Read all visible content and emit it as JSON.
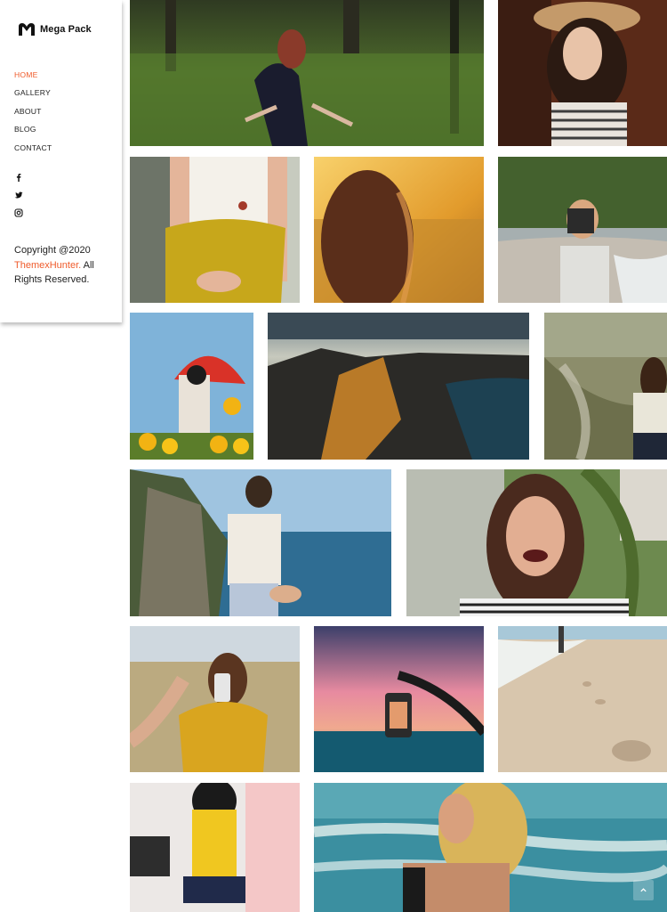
{
  "brand": {
    "name": "Mega Pack",
    "logo_icon": "m-logo-icon"
  },
  "nav": {
    "items": [
      {
        "label": "HOME",
        "active": true
      },
      {
        "label": "GALLERY",
        "active": false
      },
      {
        "label": "ABOUT",
        "active": false
      },
      {
        "label": "BLOG",
        "active": false
      },
      {
        "label": "CONTACT",
        "active": false
      }
    ]
  },
  "social": [
    "facebook-icon",
    "twitter-icon",
    "instagram-icon"
  ],
  "footer": {
    "copyright_prefix": "Copyright @2020",
    "company": "ThemexHunter.",
    "suffix": "All Rights Reserved."
  },
  "colors": {
    "accent": "#ef5b2b",
    "text": "#222222",
    "background": "#ffffff"
  },
  "gallery": {
    "photos": [
      "forest-woman-wings",
      "woman-straw-hat",
      "yellow-skirt-necklace",
      "sunset-field-hair",
      "beach-camera-woman",
      "red-umbrella-flowers",
      "mountain-lake-aerial",
      "beach-woman-back",
      "cliff-ocean-hand",
      "laughing-woman",
      "hand-phone-yellow-sweater",
      "lantern-pink-sky",
      "beach-footprints",
      "yellow-top-store",
      "blonde-woman-ocean"
    ]
  },
  "scroll_top_icon": "chevron-up-icon"
}
